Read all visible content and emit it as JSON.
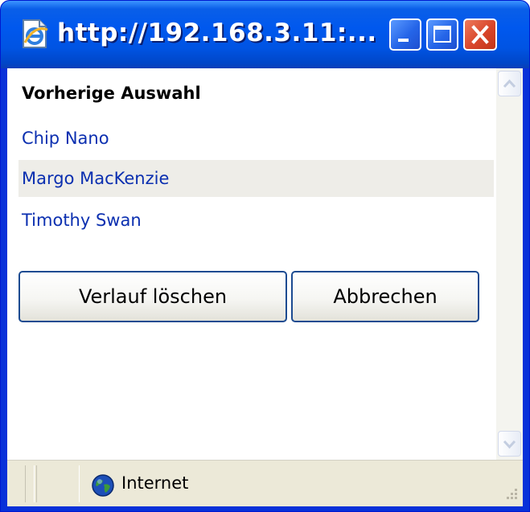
{
  "window": {
    "title": "http://192.168.3.11:...",
    "icon": "ie-page-icon",
    "controls": [
      "minimize-icon",
      "maximize-icon",
      "close-icon"
    ]
  },
  "content": {
    "heading": "Vorherige Auswahl",
    "entries": [
      "Chip Nano",
      "Margo MacKenzie",
      "Timothy Swan"
    ],
    "highlighted_entry": "Margo MacKenzie",
    "buttons": {
      "clear_label": "Verlauf löschen",
      "cancel_label": "Abbrechen"
    }
  },
  "status_bar": {
    "zone_icon": "globe-icon",
    "zone_label": "Internet"
  },
  "colors": {
    "titlebar": "#0054e3",
    "link": "#0b2fb0",
    "hover_row": "#eeede8",
    "close_button": "#d8452a",
    "statusbar": "#ece9d8"
  }
}
